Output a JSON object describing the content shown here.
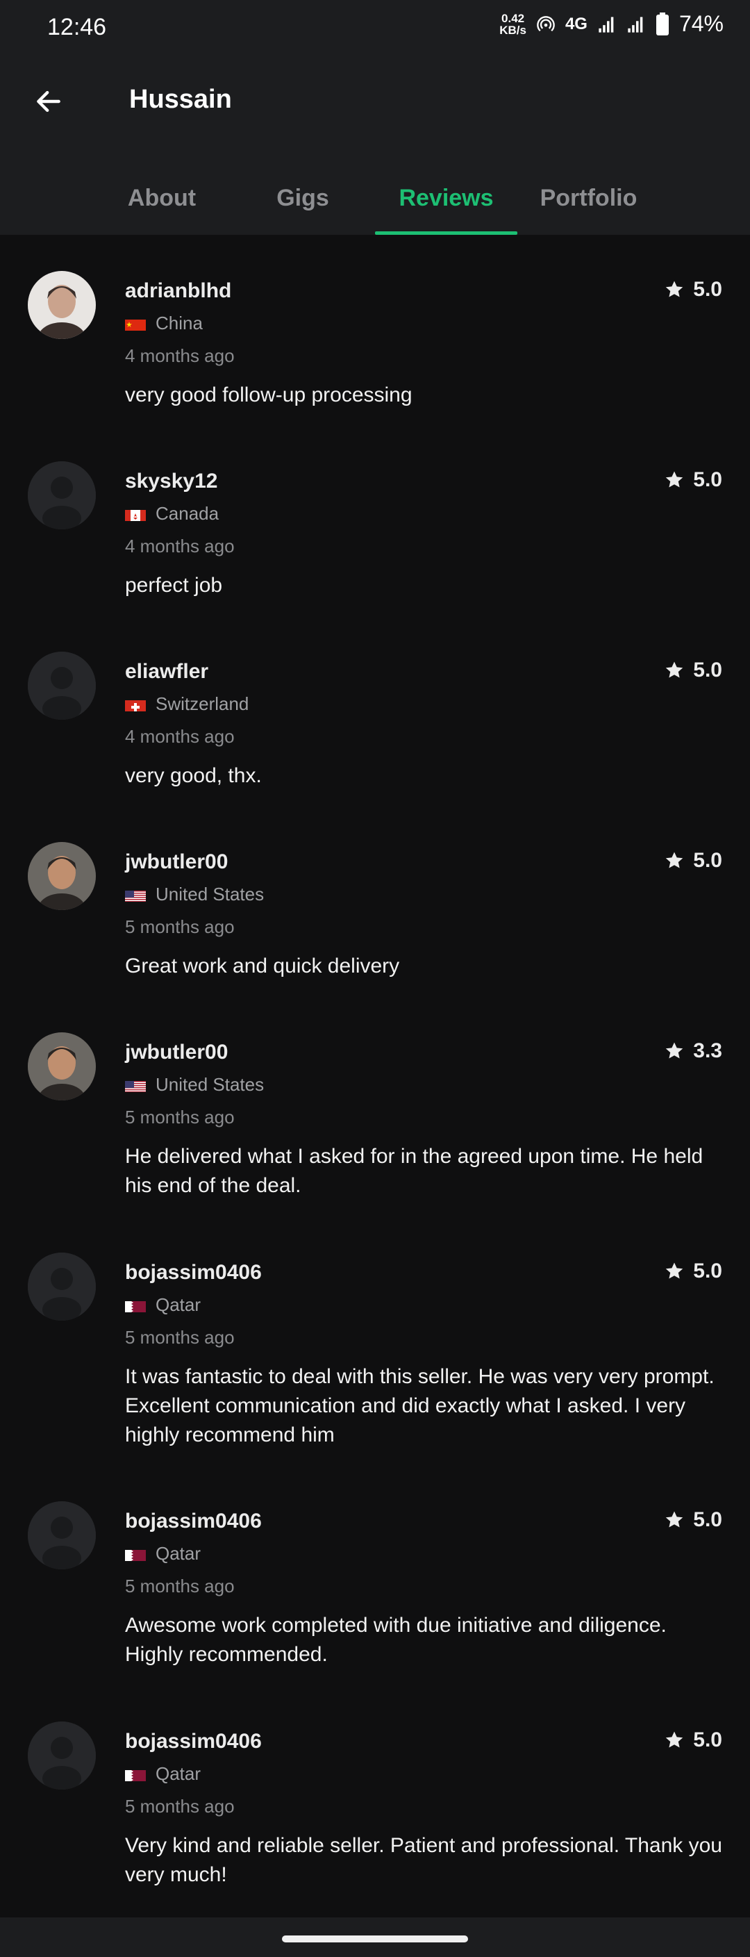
{
  "status_bar": {
    "time": "12:46",
    "net_speed_value": "0.42",
    "net_speed_unit": "KB/s",
    "network": "4G",
    "battery": "74%"
  },
  "header": {
    "title": "Hussain",
    "back_icon": "arrow-left-icon"
  },
  "tabs": [
    {
      "label": "About",
      "active": false
    },
    {
      "label": "Gigs",
      "active": false
    },
    {
      "label": "Reviews",
      "active": true
    },
    {
      "label": "Portfolio",
      "active": false
    }
  ],
  "colors": {
    "accent": "#1dbf73",
    "background": "#0f0f10",
    "header": "#1c1d1f",
    "muted_text": "#8e8f92"
  },
  "reviews": [
    {
      "reviewer": "adrianblhd",
      "country": "China",
      "flag": "cn",
      "time": "4 months ago",
      "rating": "5.0",
      "comment": "very good follow-up processing",
      "avatar": "photo"
    },
    {
      "reviewer": "skysky12",
      "country": "Canada",
      "flag": "ca",
      "time": "4 months ago",
      "rating": "5.0",
      "comment": "perfect job",
      "avatar": "placeholder"
    },
    {
      "reviewer": "eliawfler",
      "country": "Switzerland",
      "flag": "ch",
      "time": "4 months ago",
      "rating": "5.0",
      "comment": "very good, thx.",
      "avatar": "placeholder"
    },
    {
      "reviewer": "jwbutler00",
      "country": "United States",
      "flag": "us",
      "time": "5 months ago",
      "rating": "5.0",
      "comment": "Great work and quick delivery",
      "avatar": "photo"
    },
    {
      "reviewer": "jwbutler00",
      "country": "United States",
      "flag": "us",
      "time": "5 months ago",
      "rating": "3.3",
      "comment": "He delivered what I asked for in the agreed upon time. He held his end of the deal.",
      "avatar": "photo"
    },
    {
      "reviewer": "bojassim0406",
      "country": "Qatar",
      "flag": "qa",
      "time": "5 months ago",
      "rating": "5.0",
      "comment": "It was fantastic to deal with this seller. He was very very prompt. Excellent communication and did exactly what I asked. I very highly recommend him",
      "avatar": "placeholder"
    },
    {
      "reviewer": "bojassim0406",
      "country": "Qatar",
      "flag": "qa",
      "time": "5 months ago",
      "rating": "5.0",
      "comment": "Awesome work completed with due initiative and diligence. Highly recommended.",
      "avatar": "placeholder"
    },
    {
      "reviewer": "bojassim0406",
      "country": "Qatar",
      "flag": "qa",
      "time": "5 months ago",
      "rating": "5.0",
      "comment": " Very kind and reliable seller. Patient and professional. Thank you very much!",
      "avatar": "placeholder"
    }
  ]
}
